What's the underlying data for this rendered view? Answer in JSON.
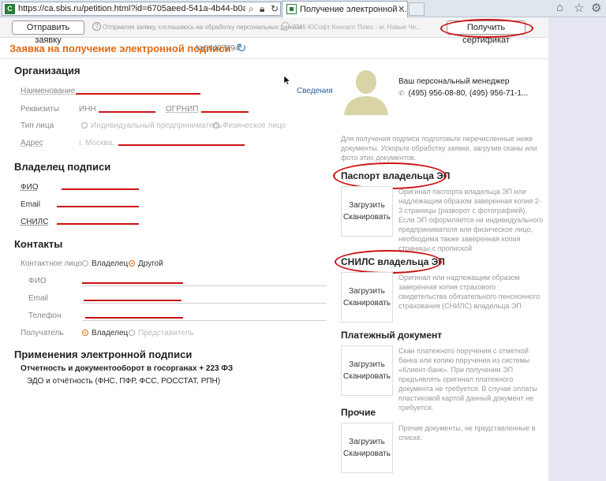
{
  "browser": {
    "url": "https://ca.sbis.ru/petition.html?id=6705aeed-541a-4b44-b0ae",
    "tab_title": "Получение электронной ...",
    "tab_close": "✕",
    "favicon": "С",
    "icons": [
      "search-icon",
      "lock-icon",
      "refresh-icon",
      "home-icon",
      "star-icon",
      "gear-icon"
    ]
  },
  "topbar": {
    "send_button": "Отправить заявку",
    "agreement": "Отправляя заявку, соглашаюсь на обработку персональных данных",
    "org": "7745 ЮСофт Консалт Плюс - м. Новые Че...",
    "get_cert_button": "Получить сертификат"
  },
  "header": {
    "title": "Заявка на получение электронной подписи",
    "number": "№58407894"
  },
  "organization": {
    "section": "Организация",
    "name_label": "Наименование",
    "details_link": "Сведения",
    "requisites_label": "Реквизиты",
    "inn_label": "ИНН",
    "ogrnip_label": "ОГРНИП",
    "type_label": "Тип лица",
    "type_option1": "Индивидуальный предприниматель",
    "type_option2": "Физическое лицо",
    "address_label": "Адрес",
    "address_value": "г. Москва,"
  },
  "owner": {
    "section": "Владелец подписи",
    "fio_label": "ФИО",
    "email_label": "Email",
    "snils_label": "СНИЛС"
  },
  "contacts": {
    "section": "Контакты",
    "contact_label": "Контактное лицо",
    "opt_owner": "Владелец",
    "opt_other": "Другой",
    "fio_label": "ФИО",
    "email_label": "Email",
    "phone_label": "Телефон",
    "recipient_label": "Получатель",
    "rec_owner": "Владелец",
    "rec_rep": "Представитель"
  },
  "usage": {
    "section": "Применения электронной подписи",
    "item1": "Отчетность и документооборот в госорганах + 223 ФЗ",
    "item2": "ЭДО и отчётность (ФНС, ПФР, ФСС, РОССТАТ, РПН)"
  },
  "manager": {
    "title": "Ваш персональный менеджер",
    "phone": "(495) 956-08-80, (495) 956-71-1..."
  },
  "documents": {
    "intro": "Для получения подписи подготовьте перечисленные ниже документы. Ускорьте обработку заявки, загрузив сканы или фото этих документов.",
    "upload": "Загрузить",
    "scan": "Сканировать",
    "passport": {
      "heading": "Паспорт владельца ЭП",
      "text": "Оригинал паспорта владельца ЭП или надлежащим образом заверенная копия 2-3 страницы (разворот с фотографией). Если ЭП оформляется на индивидуального предпринимателя или физическое лицо, необходима также заверенная копия страницы с пропиской"
    },
    "snils": {
      "heading": "СНИЛС владельца ЭП",
      "text": "Оригинал или надлежащим образом заверенная копия страхового свидетельства обязательного пенсионного страхования (СНИЛС) владельца ЭП"
    },
    "payment": {
      "heading": "Платежный документ",
      "text": "Скан платежного поручения с отметкой банка или копию поручения из системы «Клиент-банк». При получении ЭП предъявлять оригинал платежного документа не требуется. В случае оплаты пластиковой картой данный документ не требуется."
    },
    "other": {
      "heading": "Прочие",
      "text": "Прочие документы, не представленные в списке."
    }
  },
  "colors": {
    "accent": "#e06a14",
    "link": "#2a5fa8",
    "annotation": "#cc1010"
  }
}
